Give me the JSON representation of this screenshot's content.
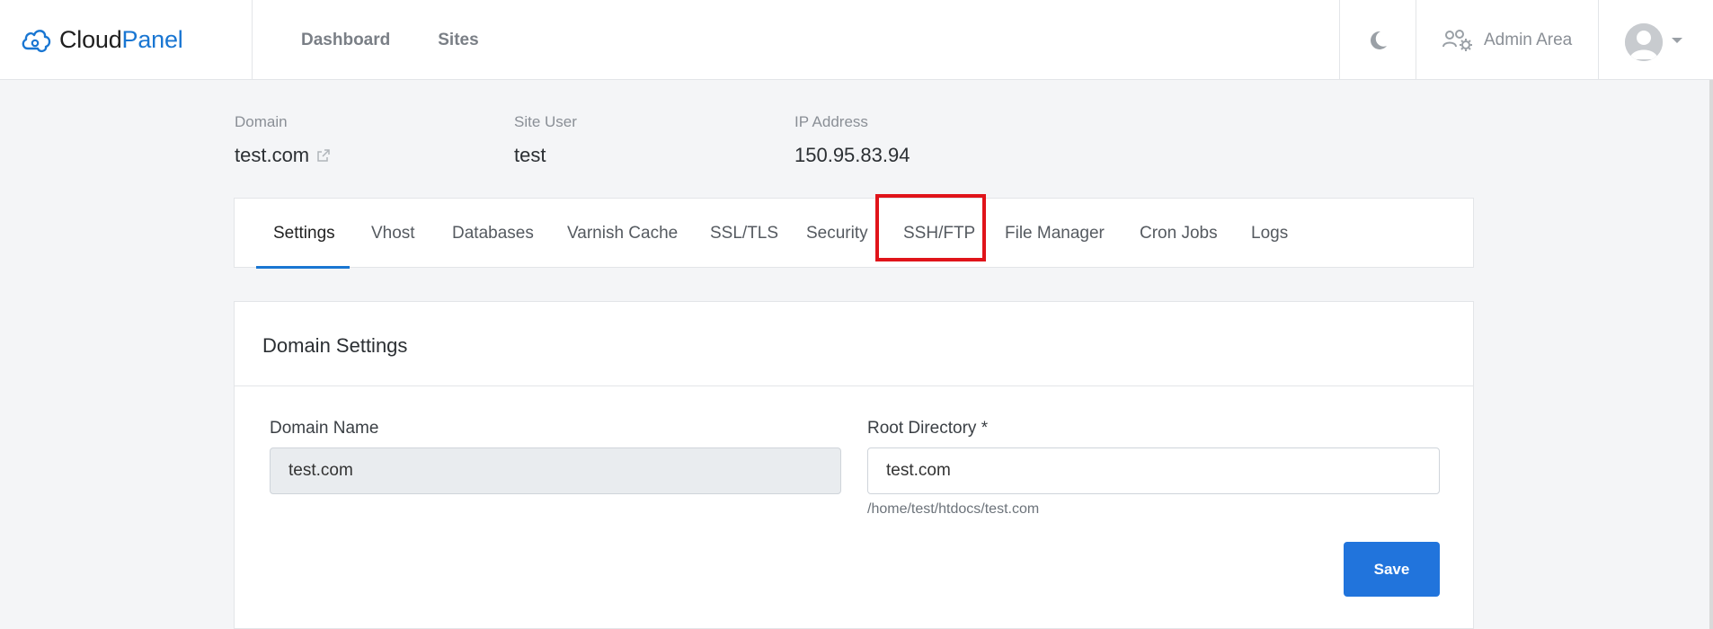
{
  "brand": {
    "name_part1": "Cloud",
    "name_part2": "Panel"
  },
  "nav": {
    "items": [
      {
        "label": "Dashboard"
      },
      {
        "label": "Sites"
      }
    ]
  },
  "topbar": {
    "admin_label": "Admin Area"
  },
  "site": {
    "domain_label": "Domain",
    "domain": "test.com",
    "user_label": "Site User",
    "user": "test",
    "ip_label": "IP Address",
    "ip": "150.95.83.94"
  },
  "tabs": [
    {
      "label": "Settings",
      "active": true
    },
    {
      "label": "Vhost"
    },
    {
      "label": "Databases"
    },
    {
      "label": "Varnish Cache"
    },
    {
      "label": "SSL/TLS"
    },
    {
      "label": "Security"
    },
    {
      "label": "SSH/FTP",
      "highlighted": true
    },
    {
      "label": "File Manager"
    },
    {
      "label": "Cron Jobs"
    },
    {
      "label": "Logs"
    }
  ],
  "card": {
    "title": "Domain Settings",
    "domain_name_label": "Domain Name",
    "domain_name_value": "test.com",
    "root_dir_label": "Root Directory *",
    "root_dir_value": "test.com",
    "root_dir_help": "/home/test/htdocs/test.com",
    "save_label": "Save"
  },
  "colors": {
    "accent": "#1976d2",
    "highlight": "#e0141a",
    "button": "#2174dc"
  }
}
